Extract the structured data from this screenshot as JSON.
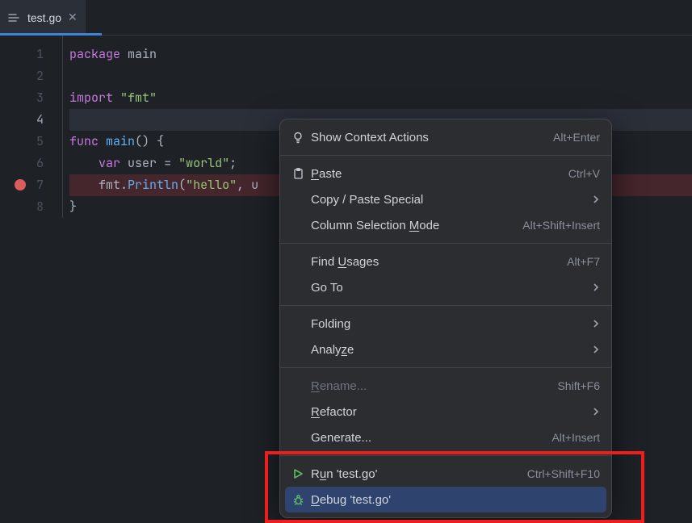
{
  "tab": {
    "filename": "test.go"
  },
  "editor": {
    "lines": [
      {
        "n": 1
      },
      {
        "n": 2
      },
      {
        "n": 3
      },
      {
        "n": 4,
        "current": true
      },
      {
        "n": 5
      },
      {
        "n": 6
      },
      {
        "n": 7,
        "breakpoint": true
      },
      {
        "n": 8
      }
    ],
    "code": {
      "l1_package": "package",
      "l1_main": "main",
      "l3_import": "import",
      "l3_fmt": "\"fmt\"",
      "l5_func": "func",
      "l5_main": "main",
      "l5_tail": "() {",
      "l6_indent": "    ",
      "l6_var": "var",
      "l6_user": "user",
      "l6_eq": " = ",
      "l6_str": "\"world\"",
      "l6_semi": ";",
      "l7_indent": "    ",
      "l7_fmt": "fmt",
      "l7_dot": ".",
      "l7_println": "Println",
      "l7_open": "(",
      "l7_str": "\"hello\"",
      "l7_comma": ", ",
      "l7_u": "u",
      "l8_brace": "}"
    }
  },
  "menu": {
    "show_context_actions": "Show Context Actions",
    "sc_context": "Alt+Enter",
    "paste_pre": "",
    "paste_u": "P",
    "paste_post": "aste",
    "sc_paste": "Ctrl+V",
    "copy_paste_special": "Copy / Paste Special",
    "col_sel_pre": "Column Selection ",
    "col_sel_u": "M",
    "col_sel_post": "ode",
    "sc_colsel": "Alt+Shift+Insert",
    "find_usages_pre": "Find ",
    "find_usages_u": "U",
    "find_usages_post": "sages",
    "sc_find": "Alt+F7",
    "goto": "Go To",
    "folding": "Folding",
    "analyze_pre": "Analy",
    "analyze_u": "z",
    "analyze_post": "e",
    "rename_pre": "",
    "rename_u": "R",
    "rename_post": "ename...",
    "sc_rename": "Shift+F6",
    "refactor_pre": "",
    "refactor_u": "R",
    "refactor_post": "efactor",
    "generate": "Generate...",
    "sc_generate": "Alt+Insert",
    "run_pre": "R",
    "run_u": "u",
    "run_post": "n 'test.go'",
    "sc_run": "Ctrl+Shift+F10",
    "debug_pre": "",
    "debug_u": "D",
    "debug_post": "ebug 'test.go'"
  }
}
